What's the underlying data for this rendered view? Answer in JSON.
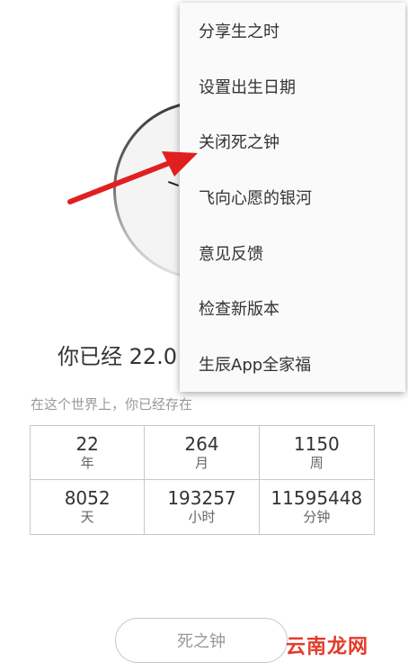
{
  "main": {
    "age_text": "你已经 22.0",
    "subtitle": "在这个世界上，你已经存在",
    "stats": [
      {
        "value": "22",
        "unit": "年"
      },
      {
        "value": "264",
        "unit": "月"
      },
      {
        "value": "1150",
        "unit": "周"
      },
      {
        "value": "8052",
        "unit": "天"
      },
      {
        "value": "193257",
        "unit": "小时"
      },
      {
        "value": "11595448",
        "unit": "分钟"
      }
    ],
    "death_button": "死之钟"
  },
  "menu": {
    "items": [
      "分享生之时",
      "设置出生日期",
      "关闭死之钟",
      "飞向心愿的银河",
      "意见反馈",
      "检查新版本",
      "生辰App全家福"
    ]
  },
  "watermark": "云南龙网",
  "colors": {
    "arrow": "#e02020",
    "watermark": "#e23c2a"
  }
}
